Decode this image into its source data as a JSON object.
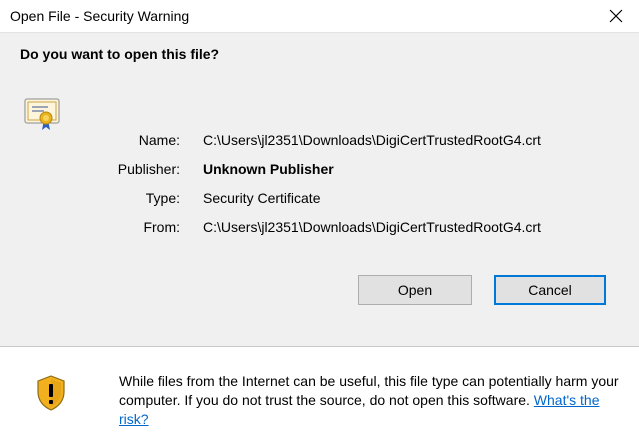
{
  "window": {
    "title": "Open File - Security Warning",
    "close_icon": "close-icon"
  },
  "dialog": {
    "question": "Do you want to open this file?",
    "icon": "certificate-icon",
    "fields": [
      {
        "label": "Name:",
        "value": "C:\\Users\\jl2351\\Downloads\\DigiCertTrustedRootG4.crt"
      },
      {
        "label": "Publisher:",
        "value": "Unknown Publisher"
      },
      {
        "label": "Type:",
        "value": "Security Certificate"
      },
      {
        "label": "From:",
        "value": "C:\\Users\\jl2351\\Downloads\\DigiCertTrustedRootG4.crt"
      }
    ]
  },
  "buttons": {
    "open_label": "Open",
    "cancel_label": "Cancel"
  },
  "footer": {
    "icon": "shield-warning-icon",
    "warning_text": "While files from the Internet can be useful, this file type can potentially harm your computer. If you do not trust the source, do not open this software.",
    "link_text": "What's the risk?"
  },
  "colors": {
    "accent": "#0078d7",
    "link": "#0066cc",
    "content_bg": "#f0f0f0",
    "shield_gold": "#f2b01e"
  }
}
